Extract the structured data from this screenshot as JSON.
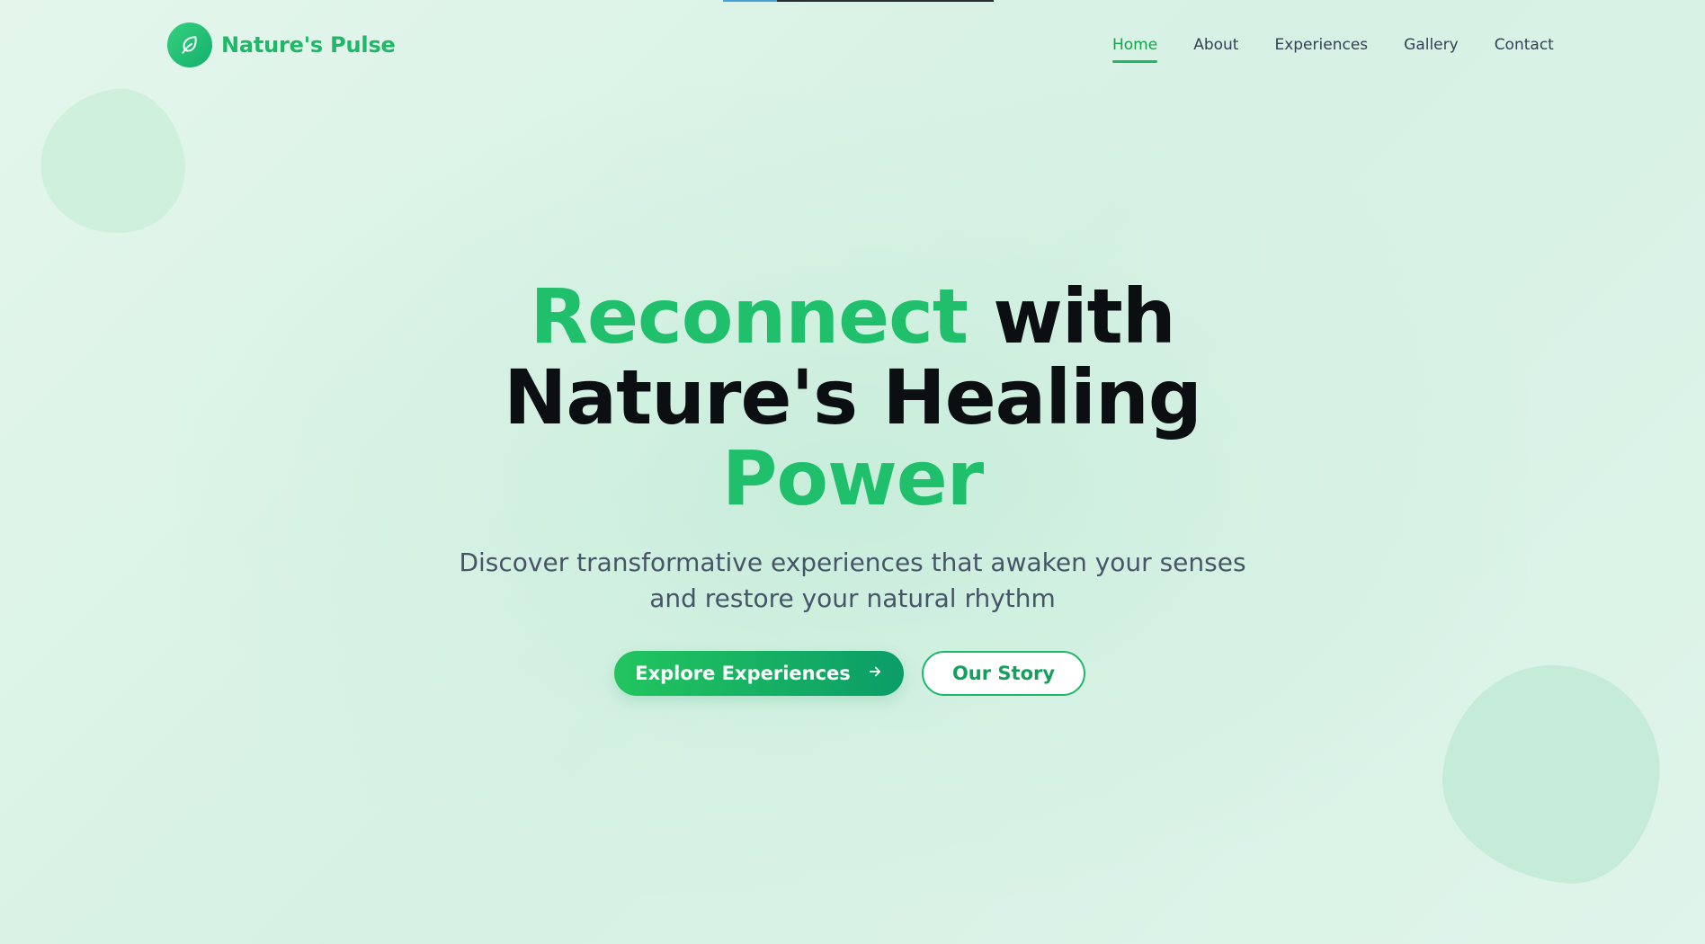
{
  "brand": {
    "name": "Nature's Pulse",
    "icon": "leaf-icon",
    "color": "#1fb868"
  },
  "nav": {
    "items": [
      {
        "label": "Home",
        "active": true
      },
      {
        "label": "About",
        "active": false
      },
      {
        "label": "Experiences",
        "active": false
      },
      {
        "label": "Gallery",
        "active": false
      },
      {
        "label": "Contact",
        "active": false
      }
    ]
  },
  "hero": {
    "title_part1": "Reconnect",
    "title_part2": " with",
    "title_part3": "Nature's Healing",
    "title_part4": "Power",
    "subtitle_line1": "Discover transformative experiences that awaken your senses",
    "subtitle_line2": "and restore your natural rhythm",
    "primary_button": "Explore Experiences",
    "primary_button_icon": "arrow-right-icon",
    "secondary_button": "Our Story"
  },
  "colors": {
    "accent": "#1fbf6b",
    "accent_dark": "#0b9d68",
    "heading": "#0b0f12",
    "body_text": "#475569",
    "background": "#dff4ea"
  }
}
